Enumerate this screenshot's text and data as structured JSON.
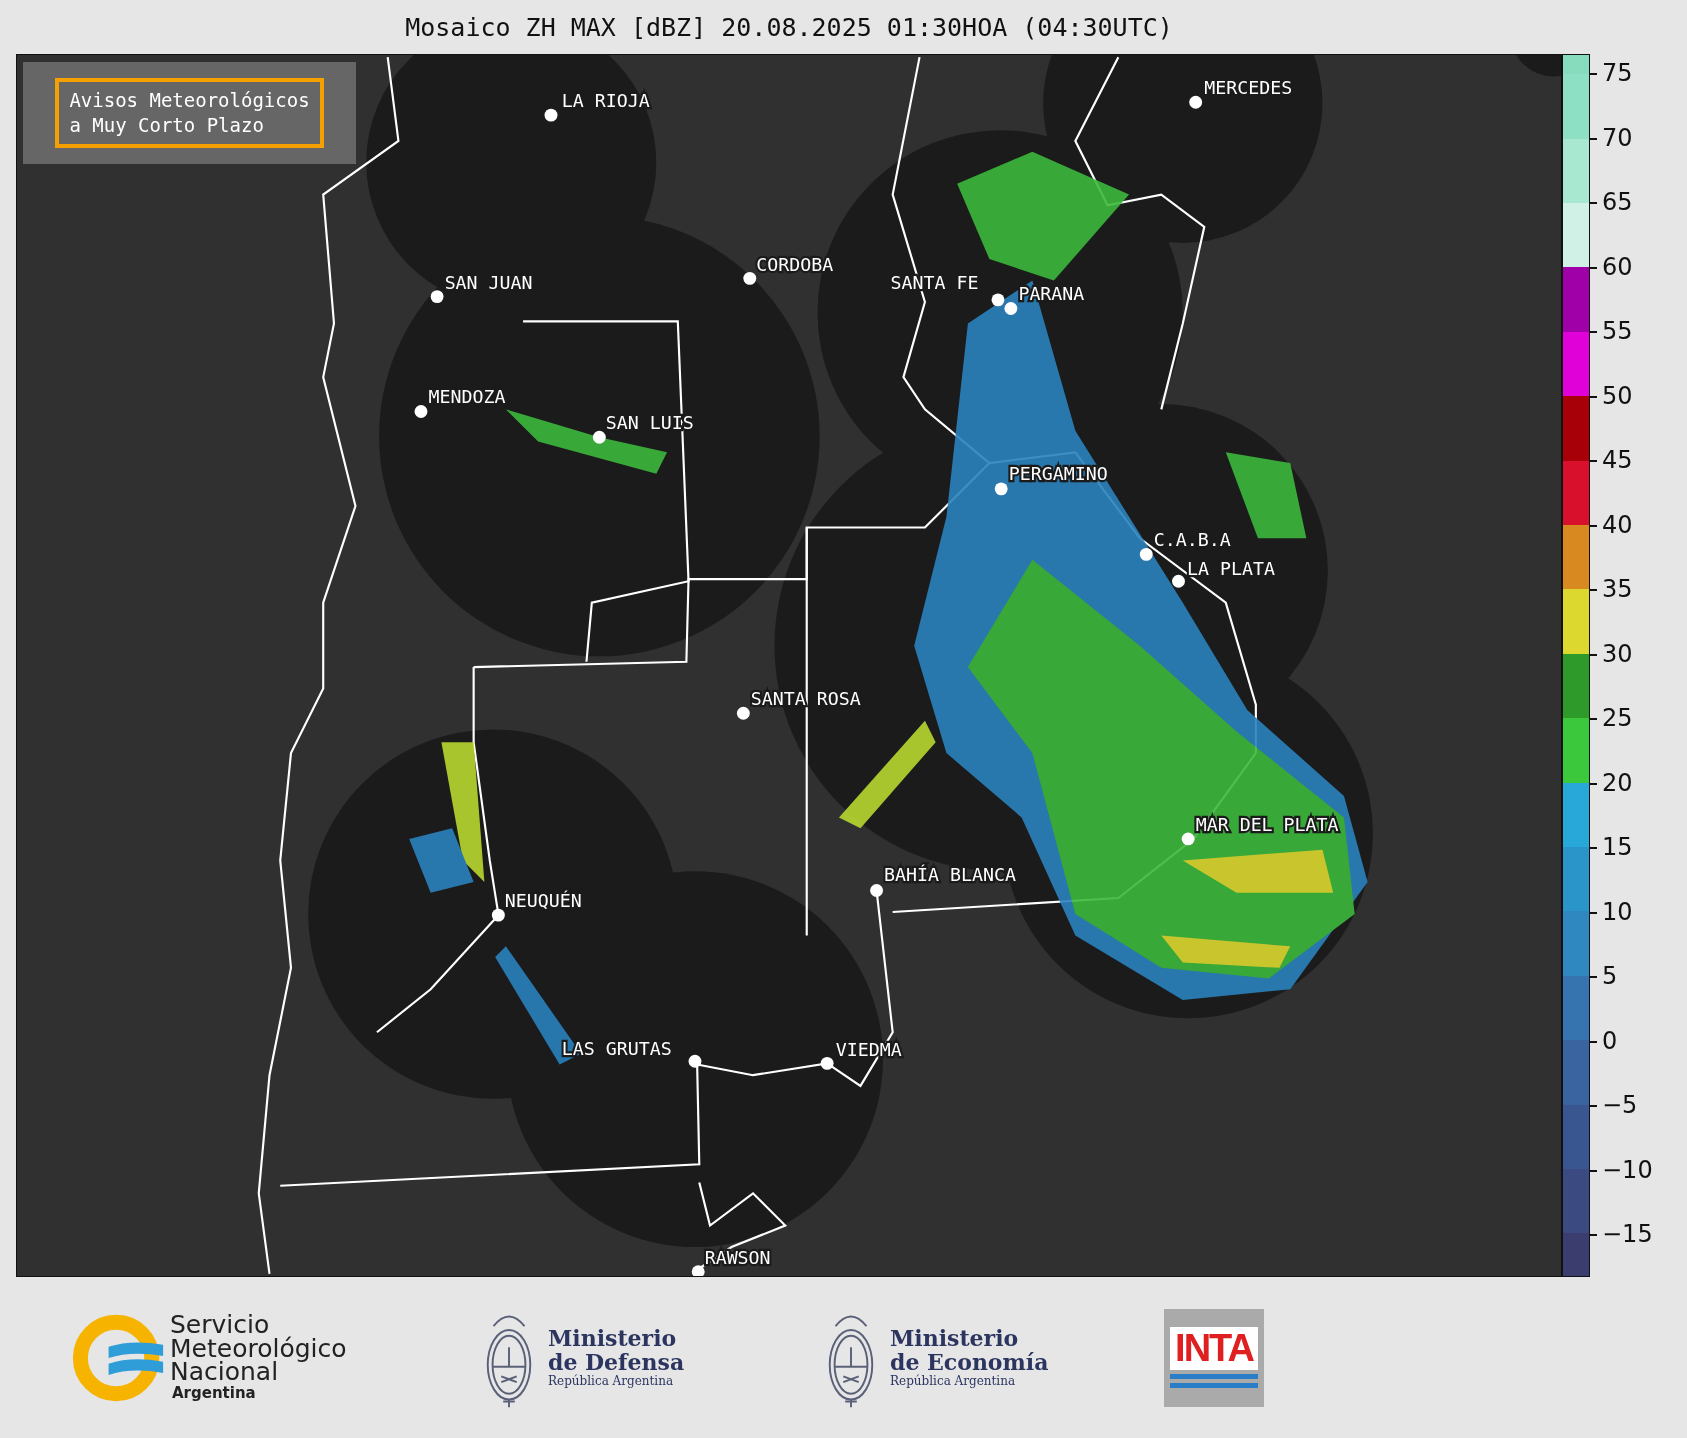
{
  "title": "Mosaico ZH MAX [dBZ] 20.08.2025 01:30HOA (04:30UTC)",
  "notice": {
    "lines": [
      "Avisos Meteorológicos",
      "a Muy Corto Plazo"
    ]
  },
  "cities": [
    {
      "name": "MERCEDES"
    },
    {
      "name": "LA RIOJA"
    },
    {
      "name": "CORDOBA"
    },
    {
      "name": "SAN JUAN"
    },
    {
      "name": "SANTA FE"
    },
    {
      "name": "PARANA"
    },
    {
      "name": "MENDOZA"
    },
    {
      "name": "SAN LUIS"
    },
    {
      "name": "PERGAMINO"
    },
    {
      "name": "C.A.B.A"
    },
    {
      "name": "LA PLATA"
    },
    {
      "name": "SANTA ROSA"
    },
    {
      "name": "MAR DEL PLATA"
    },
    {
      "name": "BAHÍA BLANCA"
    },
    {
      "name": "NEUQUÉN"
    },
    {
      "name": "LAS GRUTAS"
    },
    {
      "name": "VIEDMA"
    },
    {
      "name": "RAWSON"
    }
  ],
  "colorbar": {
    "ticks": [
      "75",
      "70",
      "65",
      "60",
      "55",
      "50",
      "45",
      "40",
      "35",
      "30",
      "25",
      "20",
      "15",
      "10",
      "5",
      "0",
      "−5",
      "−10",
      "−15"
    ],
    "bands": [
      {
        "color": "#86dcbc"
      },
      {
        "color": "#8ee0c4"
      },
      {
        "color": "#a8e8d0"
      },
      {
        "color": "#d0f2e6"
      },
      {
        "color": "#a000a8"
      },
      {
        "color": "#e000d8"
      },
      {
        "color": "#a80008"
      },
      {
        "color": "#d8102c"
      },
      {
        "color": "#d88a20"
      },
      {
        "color": "#dcd830"
      },
      {
        "color": "#2d9a2a"
      },
      {
        "color": "#3cc83c"
      },
      {
        "color": "#27a8d8"
      },
      {
        "color": "#2a95c8"
      },
      {
        "color": "#2f88c0"
      },
      {
        "color": "#3574ae"
      },
      {
        "color": "#3a64a0"
      },
      {
        "color": "#3a5690"
      },
      {
        "color": "#3b4a80"
      },
      {
        "color": "#3b3d6e"
      }
    ]
  },
  "logos": [
    {
      "kind": "smn",
      "lines": [
        "Servicio",
        "Meteorológico",
        "Nacional"
      ],
      "subtitle": "Argentina"
    },
    {
      "kind": "ministry",
      "lines": [
        "Ministerio",
        "de Defensa"
      ],
      "subtitle": "República Argentina"
    },
    {
      "kind": "ministry",
      "lines": [
        "Ministerio",
        "de Economía"
      ],
      "subtitle": "República Argentina"
    },
    {
      "kind": "inta",
      "text": "INTA"
    }
  ]
}
